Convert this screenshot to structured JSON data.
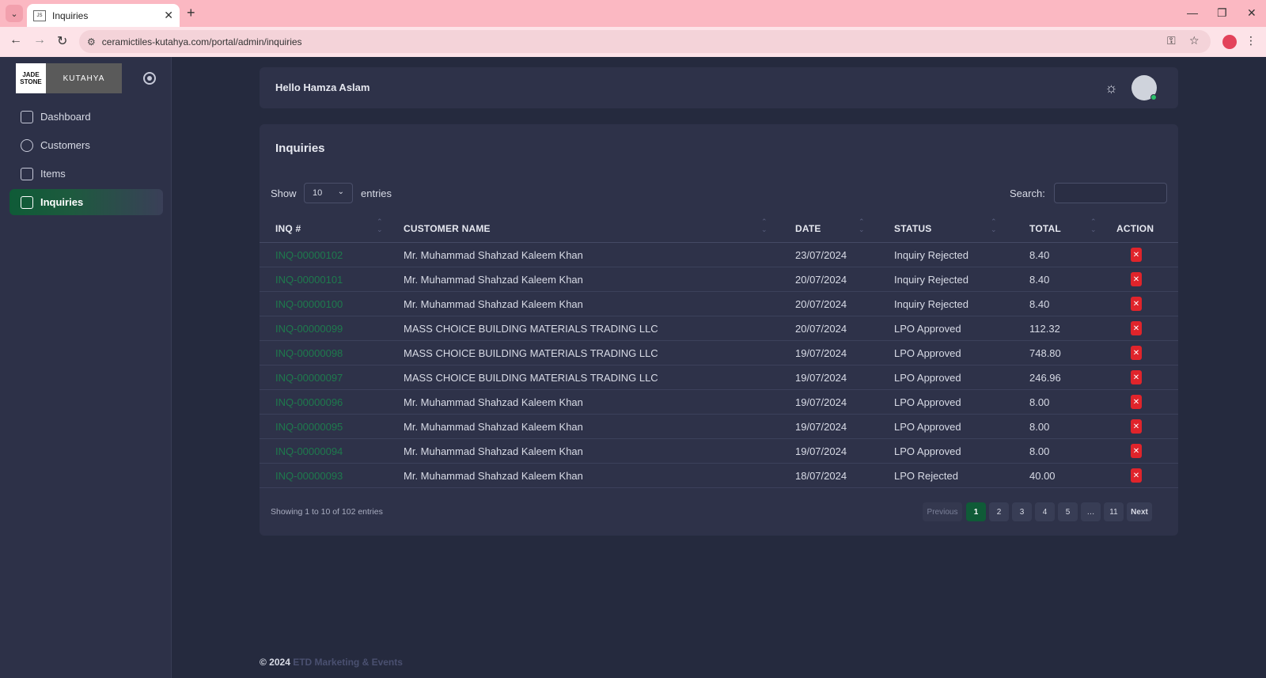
{
  "browser": {
    "tab_title": "Inquiries",
    "favicon_text": "JS",
    "url": "ceramictiles-kutahya.com/portal/admin/inquiries"
  },
  "sidebar": {
    "logo_left_1": "JADE",
    "logo_left_2": "STONE",
    "logo_right": "KUTAHYA",
    "items": [
      {
        "label": "Dashboard",
        "icon": "home-icon"
      },
      {
        "label": "Customers",
        "icon": "users-icon"
      },
      {
        "label": "Items",
        "icon": "list-icon"
      },
      {
        "label": "Inquiries",
        "icon": "clipboard-search-icon",
        "active": true
      }
    ]
  },
  "header": {
    "greeting": "Hello Hamza Aslam"
  },
  "page": {
    "title": "Inquiries",
    "show_label": "Show",
    "entries_select": "10",
    "entries_label": "entries",
    "search_label": "Search:",
    "search_value": ""
  },
  "table": {
    "columns": [
      "INQ #",
      "CUSTOMER NAME",
      "DATE",
      "STATUS",
      "TOTAL",
      "ACTION"
    ],
    "rows": [
      {
        "inq": "INQ-00000102",
        "customer": "Mr. Muhammad Shahzad Kaleem Khan",
        "date": "23/07/2024",
        "status": "Inquiry Rejected",
        "total": "8.40"
      },
      {
        "inq": "INQ-00000101",
        "customer": "Mr. Muhammad Shahzad Kaleem Khan",
        "date": "20/07/2024",
        "status": "Inquiry Rejected",
        "total": "8.40"
      },
      {
        "inq": "INQ-00000100",
        "customer": "Mr. Muhammad Shahzad Kaleem Khan",
        "date": "20/07/2024",
        "status": "Inquiry Rejected",
        "total": "8.40"
      },
      {
        "inq": "INQ-00000099",
        "customer": "MASS CHOICE BUILDING MATERIALS TRADING LLC",
        "date": "20/07/2024",
        "status": "LPO Approved",
        "total": "112.32"
      },
      {
        "inq": "INQ-00000098",
        "customer": "MASS CHOICE BUILDING MATERIALS TRADING LLC",
        "date": "19/07/2024",
        "status": "LPO Approved",
        "total": "748.80"
      },
      {
        "inq": "INQ-00000097",
        "customer": "MASS CHOICE BUILDING MATERIALS TRADING LLC",
        "date": "19/07/2024",
        "status": "LPO Approved",
        "total": "246.96"
      },
      {
        "inq": "INQ-00000096",
        "customer": "Mr. Muhammad Shahzad Kaleem Khan",
        "date": "19/07/2024",
        "status": "LPO Approved",
        "total": "8.00"
      },
      {
        "inq": "INQ-00000095",
        "customer": "Mr. Muhammad Shahzad Kaleem Khan",
        "date": "19/07/2024",
        "status": "LPO Approved",
        "total": "8.00"
      },
      {
        "inq": "INQ-00000094",
        "customer": "Mr. Muhammad Shahzad Kaleem Khan",
        "date": "19/07/2024",
        "status": "LPO Approved",
        "total": "8.00"
      },
      {
        "inq": "INQ-00000093",
        "customer": "Mr. Muhammad Shahzad Kaleem Khan",
        "date": "18/07/2024",
        "status": "LPO Rejected",
        "total": "40.00"
      }
    ],
    "action_icon": "close-icon"
  },
  "pagination": {
    "showing": "Showing 1 to 10 of 102 entries",
    "previous": "Previous",
    "pages": [
      "1",
      "2",
      "3",
      "4",
      "5",
      "…",
      "11"
    ],
    "current": "1",
    "next": "Next"
  },
  "footer": {
    "prefix": "© 2024",
    "brand": "ETD Marketing & Events"
  },
  "colors": {
    "accent": "#0f5b37",
    "danger": "#e0242b",
    "background": "#252a3e",
    "card": "#2e3249"
  }
}
